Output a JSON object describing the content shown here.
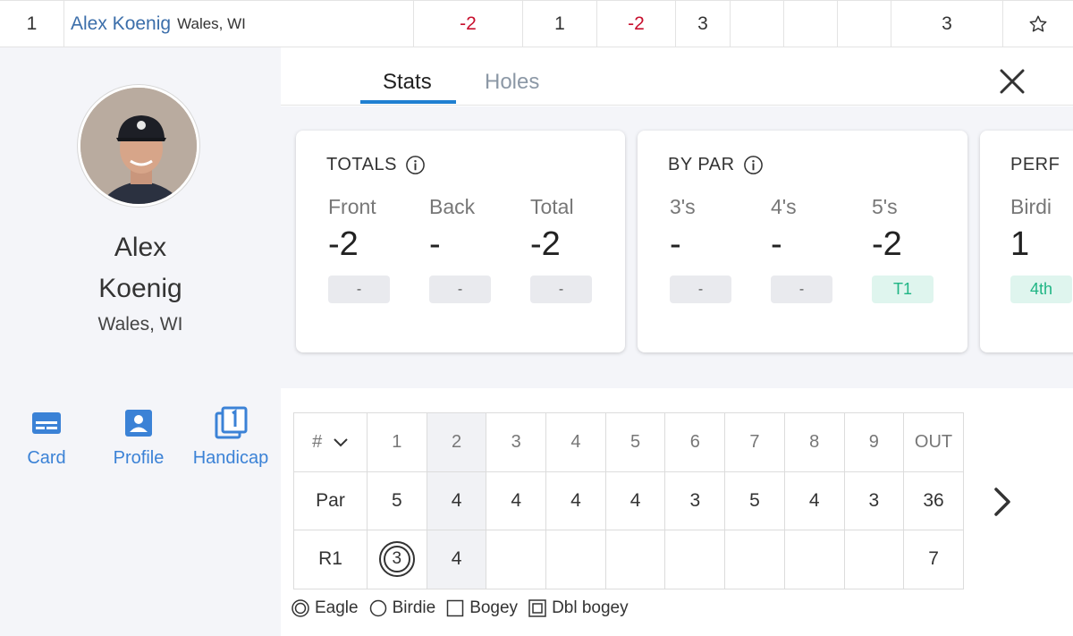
{
  "leaderboard_row": {
    "position": "1",
    "player_name": "Alex Koenig",
    "player_location": "Wales, WI",
    "to_par": "-2",
    "thru": "1",
    "today": "-2",
    "r1": "3",
    "r2": "",
    "r3": "",
    "r4": "",
    "total": "3",
    "star_icon": "star-outline-icon"
  },
  "player": {
    "first_name": "Alex",
    "last_name": "Koenig",
    "location": "Wales, WI",
    "actions": [
      {
        "label": "Card",
        "icon": "card-icon"
      },
      {
        "label": "Profile",
        "icon": "profile-icon"
      },
      {
        "label": "Handicap",
        "icon": "handicap-icon"
      }
    ]
  },
  "tabs": [
    {
      "label": "Stats",
      "active": true
    },
    {
      "label": "Holes",
      "active": false
    }
  ],
  "close_icon": "close-icon",
  "stat_cards": {
    "totals": {
      "title": "TOTALS",
      "items": [
        {
          "label": "Front",
          "value": "-2",
          "rank": "-"
        },
        {
          "label": "Back",
          "value": "-",
          "rank": "-"
        },
        {
          "label": "Total",
          "value": "-2",
          "rank": "-"
        }
      ]
    },
    "by_par": {
      "title": "BY PAR",
      "items": [
        {
          "label": "3's",
          "value": "-",
          "rank": "-"
        },
        {
          "label": "4's",
          "value": "-",
          "rank": "-"
        },
        {
          "label": "5's",
          "value": "-2",
          "rank": "T1"
        }
      ]
    },
    "performance": {
      "title": "PERF",
      "items": [
        {
          "label": "Birdi",
          "value": "1",
          "rank": "4th"
        }
      ]
    }
  },
  "scorecard": {
    "sort_label": "#",
    "holes": [
      "1",
      "2",
      "3",
      "4",
      "5",
      "6",
      "7",
      "8",
      "9",
      "OUT"
    ],
    "par_label": "Par",
    "par": [
      "5",
      "4",
      "4",
      "4",
      "4",
      "3",
      "5",
      "4",
      "3",
      "36"
    ],
    "round_label": "R1",
    "round": [
      "3",
      "4",
      "",
      "",
      "",
      "",
      "",
      "",
      "",
      "7"
    ]
  },
  "legend": [
    {
      "label": "Eagle",
      "icon": "eagle-icon"
    },
    {
      "label": "Birdie",
      "icon": "birdie-icon"
    },
    {
      "label": "Bogey",
      "icon": "bogey-icon"
    },
    {
      "label": "Dbl bogey",
      "icon": "dbl-bogey-icon"
    }
  ],
  "colors": {
    "accent": "#1f7fd1",
    "link_blue": "#3b6eaa",
    "under_par_red": "#c8102e",
    "rank_green": "#1fb584"
  }
}
